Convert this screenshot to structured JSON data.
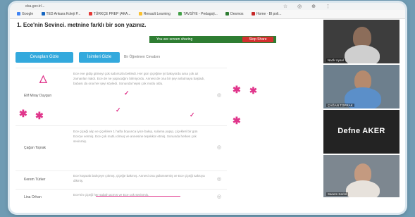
{
  "browser": {
    "address": "eba.gov.tr/...",
    "bookmarks": [
      {
        "label": "Google",
        "color": "#4285f4"
      },
      {
        "label": "TED Ankara Koleji P...",
        "color": "#1565c0"
      },
      {
        "label": "TÜRKÇE PREP (AKA...",
        "color": "#e53935"
      },
      {
        "label": "Renault Learning",
        "color": "#fbc02d"
      },
      {
        "label": "TAVSİYE - Pedagoji...",
        "color": "#43a047"
      },
      {
        "label": "Desmos",
        "color": "#2e7d32"
      },
      {
        "label": "Home · Bl poli...",
        "color": "#c62828"
      }
    ]
  },
  "question": {
    "title": "1. Ece'nin Sevinci. metnine farklı bir son yazınız."
  },
  "screen_share": {
    "message": "You are screen sharing",
    "stop_label": "Stop Share"
  },
  "buttons": {
    "answers": "Cevapları Gizle",
    "names": "İsimleri Gizle",
    "teacher_answer": "Bir Öğretmen Cevabını"
  },
  "answers": [
    {
      "name": "Elif Miray Duygun",
      "text": "Ece eve gidip gitmeyi çok sabırsızla bekledi. Her gün çiçeğine iyi bakıyordu ama çok az zamanları kaldı. Ece de ne yapacağını bilmiyordu. Annesi de ona bir şey anlatmaya başladı, babası da ona her şeyi söyledi. Sonunda hepsi çok mutlu oldu."
    },
    {
      "name": "Çağan Toprak",
      "text": "Ece çiçeği alıp ve çiçeklere 1 hafta boyunca iyice bakıp, sulama yapıp, çiçekleri bir gün Ece'ye vermiş. Ece çok mutlu olmuş ve annesine teşekkür etmiş. Sonunda herkes çok sevinmiş."
    },
    {
      "name": "Kerem Türker",
      "text": "Ece koşarak bahçeye çıkmış, çiçeğe bakmış. Annesi ona gülümsemiş ve Ece çiçeği saksıya dikmiş."
    },
    {
      "name": "Lina Orhan",
      "text": "Ece'nin çiçeği her sabah açmış ve Ece çok sevinmiş."
    }
  ],
  "participants": [
    {
      "name": "Nazlı Uysal",
      "initials": "",
      "color": "#4a4a4a"
    },
    {
      "name": "ÇAĞAN TOPRAK",
      "initials": "",
      "color": "#5a6b7a"
    },
    {
      "name": "Defne AKER",
      "initials": "Defne AKER",
      "color": "#232323"
    },
    {
      "name": "Sanem Kerim",
      "initials": "",
      "color": "#6e7a84"
    }
  ],
  "annotation_colors": {
    "pen": "#e0358b"
  }
}
